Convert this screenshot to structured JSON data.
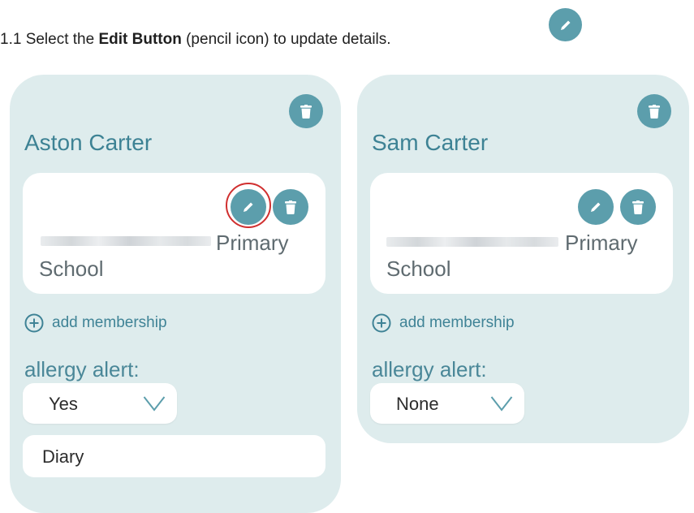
{
  "instruction": {
    "prefix": "1.1 Select the ",
    "bold": "Edit Button",
    "suffix": " (pencil icon) to update details."
  },
  "colors": {
    "accent": "#5c9eac",
    "card_bg": "#deeced",
    "highlight": "#d02f2f"
  },
  "icons": {
    "edit": "pencil-icon",
    "delete": "trash-icon",
    "add": "plus-circle-icon",
    "dropdown": "chevron-down-icon"
  },
  "children": [
    {
      "name": "Aston Carter",
      "membership": {
        "school": "Primary School",
        "redacted": true,
        "edit_highlighted": true
      },
      "add_membership_label": "add membership",
      "allergy_label": "allergy alert:",
      "allergy_value": "Yes",
      "allergy_details": "Diary"
    },
    {
      "name": "Sam Carter",
      "membership": {
        "school": "Primary School",
        "redacted": true,
        "edit_highlighted": false
      },
      "add_membership_label": "add membership",
      "allergy_label": "allergy alert:",
      "allergy_value": "None"
    }
  ]
}
